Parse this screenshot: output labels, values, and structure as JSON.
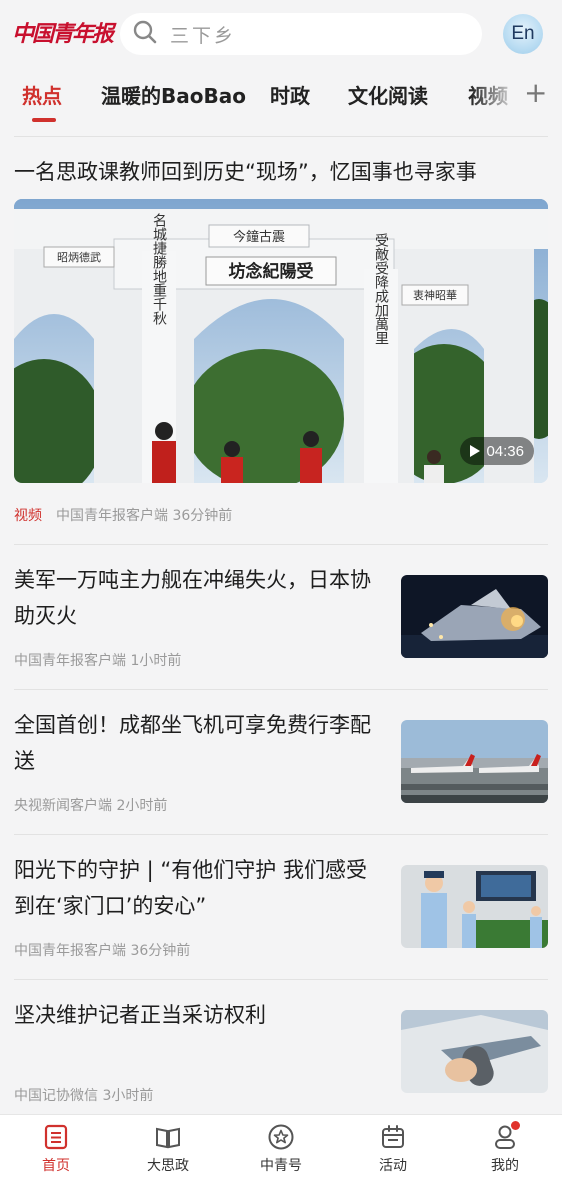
{
  "header": {
    "logo_text": "中国青年报",
    "search_placeholder": "三下乡",
    "lang_label": "En"
  },
  "tabs": [
    {
      "label": "热点",
      "active": true
    },
    {
      "label": "温暖的BaoBao",
      "active": false
    },
    {
      "label": "时政",
      "active": false
    },
    {
      "label": "文化阅读",
      "active": false
    },
    {
      "label": "视频",
      "active": false
    }
  ],
  "tabs_more": "+",
  "feature": {
    "title": "一名思政课教师回到历史“现场”，忆国事也寻家事",
    "duration": "04:36",
    "tag": "视频",
    "meta": "中国青年报客户端 36分钟前",
    "image_text": {
      "plaque_top": "今鐘古震",
      "plaque_main": "坊念紀陽受",
      "left_small": "昭炳德武",
      "right_small": "衷神昭華",
      "left_column": "名城捷勝地重千秋",
      "right_column": "受敵受降成加萬里"
    }
  },
  "news": [
    {
      "title": "美军一万吨主力舰在冲绳失火，日本协助灭火",
      "source": "中国青年报客户端 1小时前",
      "thumb": "burning-warship"
    },
    {
      "title": "全国首创！成都坐飞机可享免费行李配送",
      "source": "央视新闻客户端 2小时前",
      "thumb": "airport-planes"
    },
    {
      "title": "阳光下的守护 | “有他们守护 我们感受到在‘家门口’的安心”",
      "source": "中国青年报客户端 36分钟前",
      "thumb": "police-officers"
    },
    {
      "title": "坚决维护记者正当采访权利",
      "source": "中国记协微信 3小时前",
      "thumb": "microphone"
    }
  ],
  "bottom_nav": [
    {
      "label": "首页",
      "icon": "home-list-icon",
      "active": true
    },
    {
      "label": "大思政",
      "icon": "open-book-icon",
      "active": false
    },
    {
      "label": "中青号",
      "icon": "star-circle-icon",
      "active": false
    },
    {
      "label": "活动",
      "icon": "calendar-icon",
      "active": false
    },
    {
      "label": "我的",
      "icon": "user-icon",
      "active": false,
      "badge": true
    }
  ],
  "colors": {
    "accent": "#d0312d",
    "background": "#f4f4f5",
    "meta_text": "#9a9a9a"
  }
}
